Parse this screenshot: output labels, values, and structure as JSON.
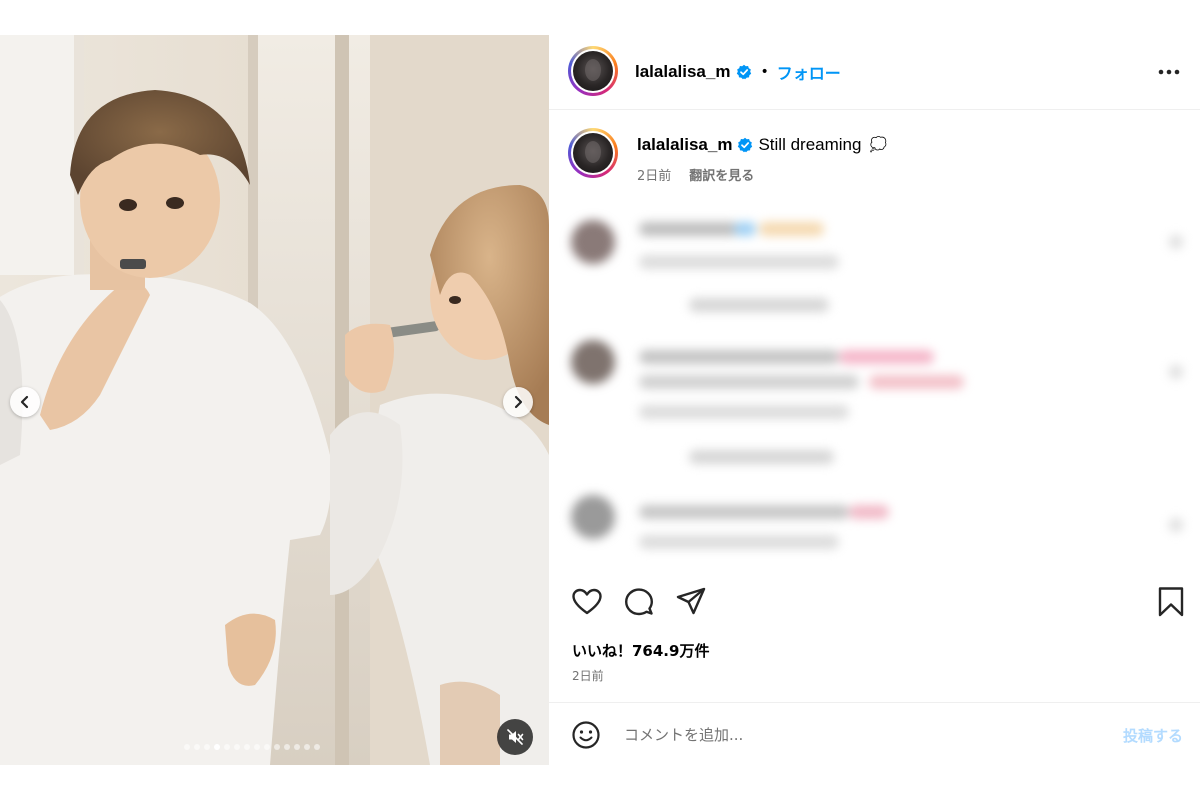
{
  "post": {
    "media_label": "post-photo",
    "carousel": {
      "total": 14,
      "active_index": 3
    }
  },
  "header": {
    "username": "lalalalisa_m",
    "separator": "•",
    "follow_label": "フォロー",
    "more_icon": "more-options-icon"
  },
  "caption": {
    "username": "lalalalisa_m",
    "text": "Still dreaming",
    "emoji": "💭",
    "time": "2日前",
    "translate_label": "翻訳を見る"
  },
  "stats": {
    "likes_text": "いいね！764.9万件",
    "date": "2日前"
  },
  "comment_box": {
    "placeholder": "コメントを追加...",
    "post_label": "投稿する"
  },
  "colors": {
    "accent": "#0095f6",
    "post_disabled": "#b3dbff",
    "muted_text": "#737373",
    "divider": "#efefef"
  },
  "icons": {
    "like": "heart-icon",
    "comment": "comment-icon",
    "share": "share-icon",
    "save": "bookmark-icon",
    "emoji": "emoji-icon",
    "verified": "verified-badge-icon",
    "prev": "chevron-left-icon",
    "next": "chevron-right-icon",
    "mute": "mute-icon"
  }
}
